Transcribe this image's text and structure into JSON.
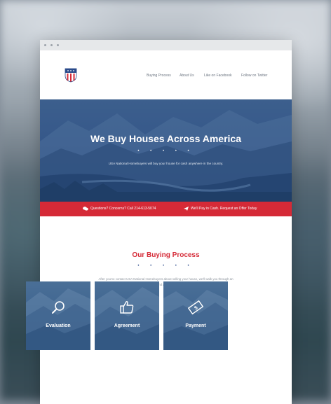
{
  "nav": {
    "items": [
      "Buying Process",
      "About Us",
      "Like on Facebook",
      "Follow on Twitter"
    ]
  },
  "hero": {
    "title": "We Buy Houses Across America",
    "dots": "• • • • •",
    "subtitle": "USA National Homebuyers will buy your house for cash anywhere in the country."
  },
  "banner": {
    "left": "Questions? Concerns? Call 214-613-5074",
    "right": "We'll Pay in Cash. Request an Offer Today"
  },
  "process": {
    "title": "Our Buying Process",
    "dots": "• • • • •",
    "text": "After you've contact USA National Homebuyers about selling your house, we'll walk you through an easy buying process and answer any of your questions."
  },
  "cards": [
    {
      "label": "Evaluation",
      "icon": "magnifier-icon"
    },
    {
      "label": "Agreement",
      "icon": "thumbs-up-icon"
    },
    {
      "label": "Payment",
      "icon": "cash-icon"
    }
  ],
  "colors": {
    "accent": "#d52a37",
    "hero_blue": "#36588a"
  }
}
